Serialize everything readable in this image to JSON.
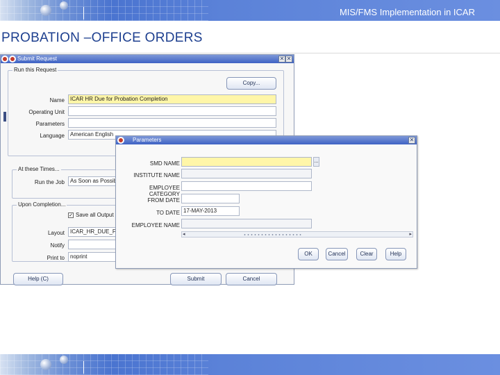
{
  "slide": {
    "banner_title": "MIS/FMS Implementation in ICAR",
    "title": "PROBATION –OFFICE ORDERS"
  },
  "submit_window": {
    "title": "Submit Request",
    "group_run": "Run this Request",
    "copy_button": "Copy...",
    "labels": {
      "name": "Name",
      "operating_unit": "Operating Unit",
      "parameters": "Parameters",
      "language": "Language"
    },
    "values": {
      "name": "ICAR HR Due for Probation Completion",
      "operating_unit": "",
      "parameters": "",
      "language": "American English"
    },
    "group_times": "At these Times...",
    "run_job_label": "Run the Job",
    "run_job_value": "As Soon as Possible",
    "group_completion": "Upon Completion...",
    "save_output_label": "Save all Output Files",
    "labels2": {
      "layout": "Layout",
      "notify": "Notify",
      "print_to": "Print to"
    },
    "values2": {
      "layout": "ICAR_HR_DUE_FOR_",
      "notify": "",
      "print_to": "noprint"
    },
    "help_button": "Help (C)",
    "submit_button": "Submit",
    "cancel_button": "Cancel"
  },
  "params_window": {
    "title": "Parameters",
    "labels": {
      "smd_name": "SMD NAME",
      "institute_name": "INSTITUTE NAME",
      "employee_category": "EMPLOYEE CATEGORY",
      "from_date": "FROM DATE",
      "to_date": "TO DATE",
      "employee_name": "EMPLOYEE NAME"
    },
    "values": {
      "smd_name": "",
      "institute_name": "",
      "employee_category": "",
      "from_date": "",
      "to_date": "17-MAY-2013",
      "employee_name": ""
    },
    "lov_glyph": "...",
    "ok_button": "OK",
    "cancel_button": "Cancel",
    "clear_button": "Clear",
    "help_button": "Help"
  }
}
